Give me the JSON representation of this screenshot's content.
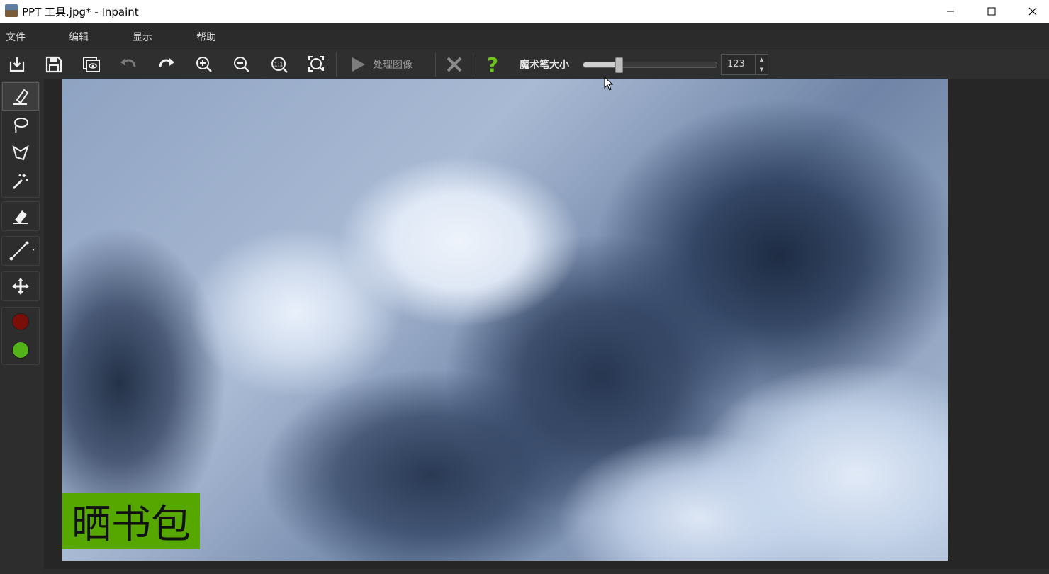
{
  "window": {
    "title": "PPT 工具.jpg* - Inpaint",
    "icon": "app-image-icon"
  },
  "menu": {
    "items": [
      {
        "label": "文件"
      },
      {
        "label": "编辑"
      },
      {
        "label": "显示"
      },
      {
        "label": "帮助"
      }
    ]
  },
  "toolbar": {
    "process_label": "处理图像",
    "brush_size_label": "魔术笔大小",
    "brush_size_value": "123",
    "brush_size_fraction": 0.26,
    "icons": [
      "open-icon",
      "save-icon",
      "preview-icon",
      "undo-icon",
      "redo-icon",
      "zoom-in-icon",
      "zoom-out-icon",
      "actual-size-icon",
      "fit-icon",
      "play-icon",
      "cancel-icon",
      "help-icon"
    ]
  },
  "tools": {
    "marker_color": "#7a0f0a",
    "donor_color": "#52b416",
    "icons": [
      "marker-icon",
      "lasso-icon",
      "polygon-lasso-icon",
      "magic-wand-icon",
      "eraser-icon",
      "line-icon",
      "move-icon"
    ]
  },
  "canvas": {
    "watermark_text": "晒书包",
    "watermark_color": "#56a800"
  }
}
